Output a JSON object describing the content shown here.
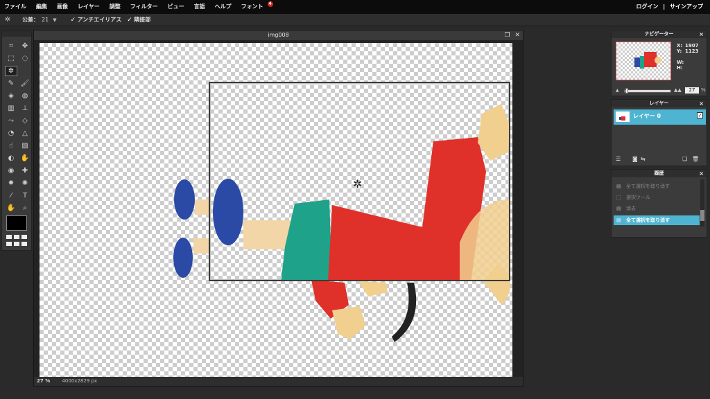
{
  "menubar": {
    "items": [
      {
        "label": "ファイル"
      },
      {
        "label": "編集"
      },
      {
        "label": "画像"
      },
      {
        "label": "レイヤー"
      },
      {
        "label": "調整"
      },
      {
        "label": "フィルター"
      },
      {
        "label": "ビュー"
      },
      {
        "label": "言語"
      },
      {
        "label": "ヘルプ"
      },
      {
        "label": "フォント",
        "badge": "4"
      }
    ],
    "login": "ログイン",
    "separator": "|",
    "signup": "サインアップ"
  },
  "options": {
    "tool_icon": "magic-wand-icon",
    "tolerance_label": "公差：",
    "tolerance_value": "21",
    "antialias_label": "アンチエイリアス",
    "antialias_checked": true,
    "contiguous_label": "隣接部",
    "contiguous_checked": true
  },
  "toolbox": {
    "tools": [
      "crop-icon",
      "move-icon",
      "marquee-icon",
      "lasso-icon",
      "magic-wand-icon",
      "",
      "pencil-icon",
      "brush-icon",
      "eraser-icon",
      "paint-bucket-icon",
      "gradient-icon",
      "clone-stamp-icon",
      "color-replace-icon",
      "drawing-icon",
      "blur-icon",
      "sharpen-icon",
      "smudge-icon",
      "sponge-icon",
      "dodge-icon",
      "burn-icon",
      "red-eye-icon",
      "spot-heal-icon",
      "bloat-icon",
      "pinch-icon",
      "color-picker-icon",
      "type-icon",
      "hand-icon",
      "zoom-icon"
    ],
    "active_tool": "magic-wand-icon",
    "foreground_color": "#000000"
  },
  "document": {
    "title": "img008",
    "zoom": "27",
    "zoom_unit": "%",
    "size": "4000x2829 px"
  },
  "navigator": {
    "title": "ナビゲーター",
    "x_label": "X:",
    "x_value": "1907",
    "y_label": "Y:",
    "y_value": "1123",
    "w_label": "W:",
    "h_label": "H:",
    "zoom_value": "27",
    "zoom_unit": "%"
  },
  "layers": {
    "title": "レイヤー",
    "items": [
      {
        "name": "レイヤー 0",
        "visible": true
      }
    ]
  },
  "history": {
    "title": "履歴",
    "items": [
      {
        "label": "全て選択を取り消す",
        "active": false
      },
      {
        "label": "選択ツール",
        "active": false
      },
      {
        "label": "消去",
        "active": false
      },
      {
        "label": "全て選択を取り消す",
        "active": true
      }
    ]
  },
  "colors": {
    "accent": "#4fb4d2",
    "menubar_bg": "#0c0c0c",
    "panel_bg": "#3b3b3b"
  }
}
